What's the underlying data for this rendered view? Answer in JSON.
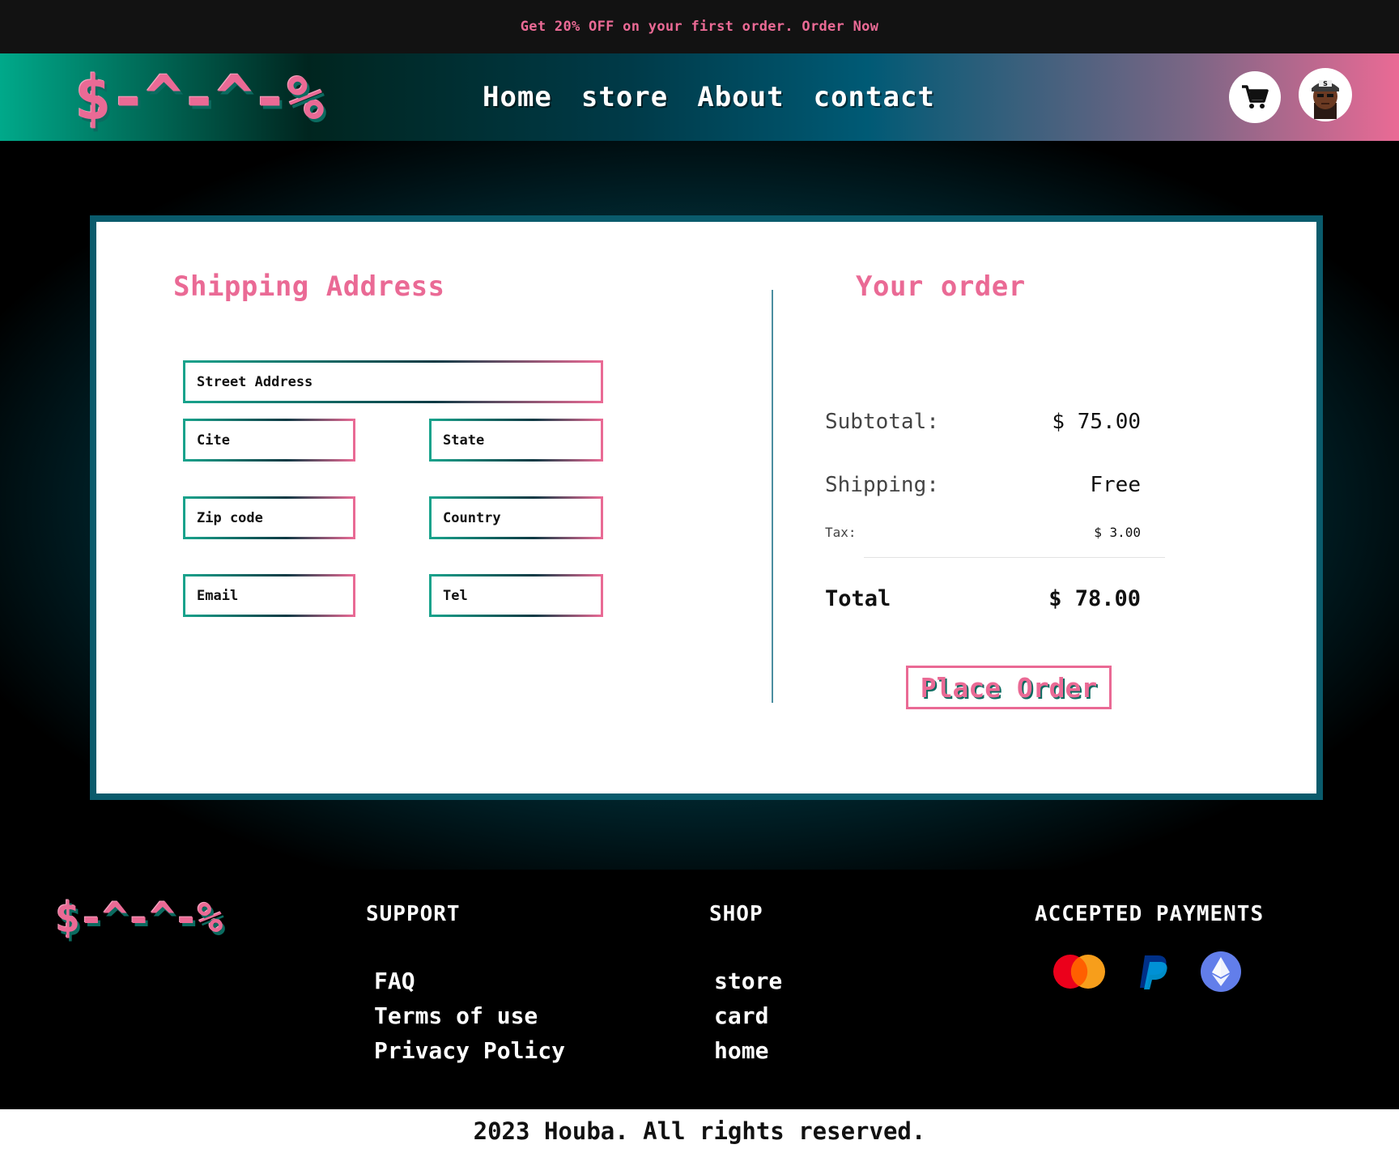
{
  "promo": {
    "text": "Get 20% OFF on your first order. Order Now"
  },
  "header": {
    "logo": "$-^-^-%",
    "nav": [
      "Home",
      "store",
      "About",
      "contact"
    ]
  },
  "shipping": {
    "title": "Shipping Address",
    "placeholders": {
      "street": "Street Address",
      "city": "Cite",
      "state": "State",
      "zip": "Zip code",
      "country": "Country",
      "email": "Email",
      "tel": "Tel"
    }
  },
  "order": {
    "title": "Your order",
    "subtotal_label": "Subtotal:",
    "subtotal_value": "$ 75.00",
    "shipping_label": "Shipping:",
    "shipping_value": "Free",
    "tax_label": "Tax:",
    "tax_value": "$ 3.00",
    "total_label": "Total",
    "total_value": "$ 78.00",
    "place_order": "Place Order"
  },
  "footer": {
    "logo": "$-^-^-%",
    "support": {
      "heading": "SUPPORT",
      "links": [
        "FAQ",
        "Terms of use",
        "Privacy Policy"
      ]
    },
    "shop": {
      "heading": "SHOP",
      "links": [
        "store",
        "card",
        "home"
      ]
    },
    "payments": {
      "heading": "ACCEPTED PAYMENTS",
      "icons": [
        "mastercard-icon",
        "paypal-icon",
        "ethereum-icon"
      ]
    }
  },
  "copyright": "2023 Houba. All rights reserved.",
  "colors": {
    "accent": "#ea6a95",
    "teal": "#19a38c",
    "dark_teal": "#0a5b6c"
  }
}
